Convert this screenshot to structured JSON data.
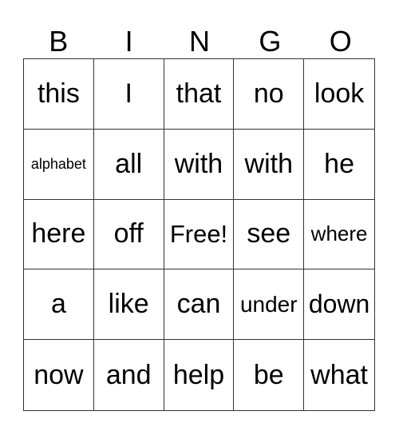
{
  "header": [
    "B",
    "I",
    "N",
    "G",
    "O"
  ],
  "cells": [
    "this",
    "I",
    "that",
    "no",
    "look",
    "alphabet",
    "all",
    "with",
    "with",
    "he",
    "here",
    "off",
    "Free!",
    "see",
    "where",
    "a",
    "like",
    "can",
    "under",
    "down",
    "now",
    "and",
    "help",
    "be",
    "what"
  ]
}
